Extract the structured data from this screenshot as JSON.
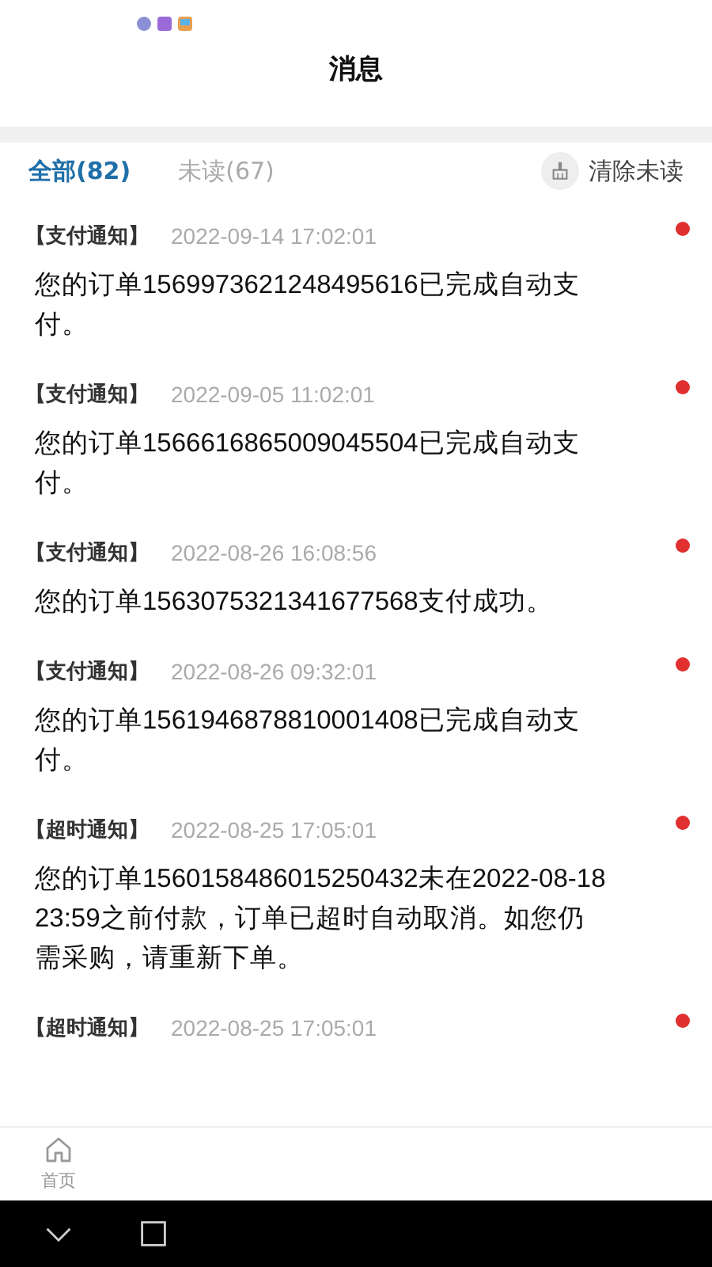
{
  "header": {
    "title": "消息"
  },
  "tabs": [
    {
      "label": "全部(82)",
      "selected": true
    },
    {
      "label": "未读(67)",
      "selected": false
    }
  ],
  "clear_button": {
    "label": "清除未读"
  },
  "messages": [
    {
      "tag": "【支付通知】",
      "time": "2022-09-14 17:02:01",
      "text": "您的订单1569973621248495616已完成自动支付。",
      "unread": true
    },
    {
      "tag": "【支付通知】",
      "time": "2022-09-05 11:02:01",
      "text": "您的订单1566616865009045504已完成自动支付。",
      "unread": true
    },
    {
      "tag": "【支付通知】",
      "time": "2022-08-26 16:08:56",
      "text": "您的订单1563075321341677568支付成功。",
      "unread": true
    },
    {
      "tag": "【支付通知】",
      "time": "2022-08-26 09:32:01",
      "text": "您的订单1561946878810001408已完成自动支付。",
      "unread": true
    },
    {
      "tag": "【超时通知】",
      "time": "2022-08-25 17:05:01",
      "text": "您的订单1560158486015250432未在2022-08-18 23:59之前付款，订单已超时自动取消。如您仍需采购，请重新下单。",
      "unread": true
    },
    {
      "tag": "【超时通知】",
      "time": "2022-08-25 17:05:01",
      "unread": true
    }
  ],
  "bottom_nav": [
    {
      "label": "首页",
      "selected": false
    }
  ]
}
